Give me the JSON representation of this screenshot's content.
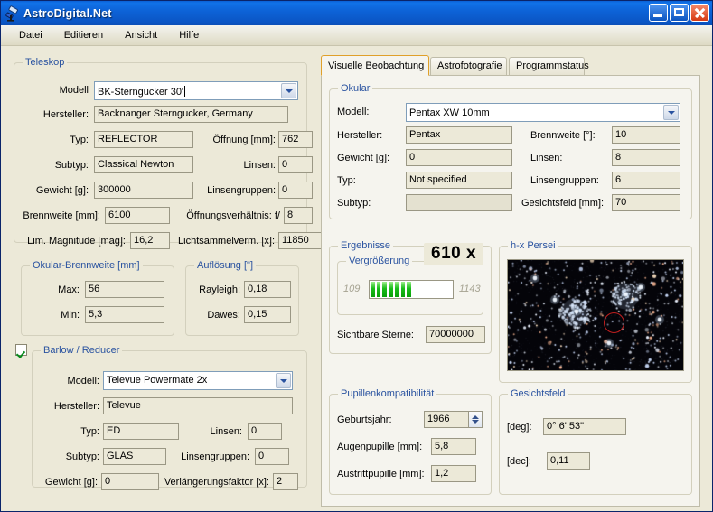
{
  "window": {
    "title": "AstroDigital.Net",
    "icon": "telescope-icon",
    "minimize_label": "Minimieren",
    "maximize_label": "Maximieren",
    "close_label": "Schließen"
  },
  "menu": {
    "items": [
      "Datei",
      "Editieren",
      "Ansicht",
      "Hilfe"
    ]
  },
  "teleskop": {
    "caption": "Teleskop",
    "modell_label": "Modell",
    "modell_value": "BK-Sterngucker 30'",
    "hersteller_label": "Hersteller:",
    "hersteller_value": "Backnanger Sterngucker, Germany",
    "typ_label": "Typ:",
    "typ_value": "REFLECTOR",
    "oeffnung_label": "Öffnung [mm]:",
    "oeffnung_value": "762",
    "subtyp_label": "Subtyp:",
    "subtyp_value": "Classical Newton",
    "linsen_label": "Linsen:",
    "linsen_value": "0",
    "gewicht_label": "Gewicht [g]:",
    "gewicht_value": "300000",
    "linsengruppen_label": "Linsengruppen:",
    "linsengruppen_value": "0",
    "brennweite_label": "Brennweite [mm]:",
    "brennweite_value": "6100",
    "oeffnungsverhaeltnis_label": "Öffnungsverhältnis: f/",
    "oeffnungsverhaeltnis_value": "8",
    "limmag_label": "Lim. Magnitude [mag]:",
    "limmag_value": "16,2",
    "lichtsammel_label": "Lichtsammelverm. [x]:",
    "lichtsammel_value": "11850"
  },
  "okular_brennweite": {
    "caption": "Okular-Brennweite [mm]",
    "max_label": "Max:",
    "max_value": "56",
    "min_label": "Min:",
    "min_value": "5,3"
  },
  "aufloesung": {
    "caption": "Auflösung [\"]",
    "rayleigh_label": "Rayleigh:",
    "rayleigh_value": "0,18",
    "dawes_label": "Dawes:",
    "dawes_value": "0,15"
  },
  "barlow": {
    "caption": "Barlow / Reducer",
    "enabled": true,
    "modell_label": "Modell:",
    "modell_value": "Televue Powermate 2x",
    "hersteller_label": "Hersteller:",
    "hersteller_value": "Televue",
    "typ_label": "Typ:",
    "typ_value": "ED",
    "linsen_label": "Linsen:",
    "linsen_value": "0",
    "subtyp_label": "Subtyp:",
    "subtyp_value": "GLAS",
    "linsengruppen_label": "Linsengruppen:",
    "linsengruppen_value": "0",
    "gewicht_label": "Gewicht [g]:",
    "gewicht_value": "0",
    "verlaengerung_label": "Verlängerungsfaktor [x]:",
    "verlaengerung_value": "2"
  },
  "tabs": [
    {
      "label": "Visuelle Beobachtung",
      "active": true
    },
    {
      "label": "Astrofotografie",
      "active": false
    },
    {
      "label": "Programmstatus",
      "active": false
    }
  ],
  "okular": {
    "caption": "Okular",
    "modell_label": "Modell:",
    "modell_value": "Pentax XW 10mm",
    "hersteller_label": "Hersteller:",
    "hersteller_value": "Pentax",
    "brennweite_label": "Brennweite [°]:",
    "brennweite_value": "10",
    "gewicht_label": "Gewicht [g]:",
    "gewicht_value": "0",
    "linsen_label": "Linsen:",
    "linsen_value": "8",
    "typ_label": "Typ:",
    "typ_value": "Not specified",
    "linsengruppen_label": "Linsengruppen:",
    "linsengruppen_value": "6",
    "subtyp_label": "Subtyp:",
    "subtyp_value": "",
    "gesichtsfeld_label": "Gesichtsfeld [mm]:",
    "gesichtsfeld_value": "70"
  },
  "ergebnisse": {
    "caption": "Ergebnisse",
    "vergroesserung_caption": "Vergrößerung",
    "vergroesserung_value": "610 x",
    "range_min": "109",
    "range_max": "1143",
    "progress_percent": 50,
    "progress_segments": 7,
    "sichtbare_sterne_label": "Sichtbare Sterne:",
    "sichtbare_sterne_value": "70000000"
  },
  "pupillenkompatibilitaet": {
    "caption": "Pupillenkompatibilität",
    "geburtsjahr_label": "Geburtsjahr:",
    "geburtsjahr_value": "1966",
    "augenpupille_label": "Augenpupille [mm]:",
    "augenpupille_value": "5,8",
    "austrittpupille_label": "Austrittpupille [mm]:",
    "austrittpupille_value": "1,2"
  },
  "starfield": {
    "caption": "h-x Persei",
    "marker": "red-circle-overlay"
  },
  "gesichtsfeld": {
    "caption": "Gesichtsfeld",
    "deg_label": "[deg]:",
    "deg_value": "0° 6' 53\"",
    "dec_label": "[dec]:",
    "dec_value": "0,11"
  },
  "colors": {
    "form_background": "#ece9d8",
    "tab_panel_background": "#f5f4ee",
    "group_caption": "#2a53a0",
    "title_bar": "#0d63d8",
    "progress_green": "#18bb18",
    "active_tab_border": "#e0a02a",
    "marker_red": "#c21f1f"
  }
}
